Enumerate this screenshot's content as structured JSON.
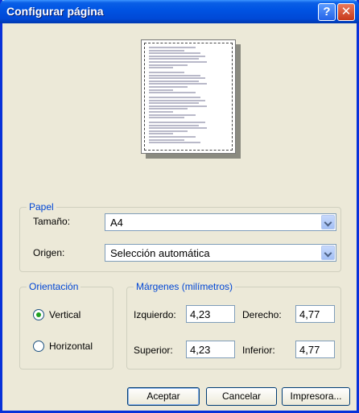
{
  "window": {
    "title": "Configurar página"
  },
  "titlebar": {
    "help_label": "?",
    "close_label": "✕"
  },
  "paper": {
    "group_label": "Papel",
    "size_label": "Tamaño:",
    "size_value": "A4",
    "source_label": "Origen:",
    "source_value": "Selección automática"
  },
  "orientation": {
    "group_label": "Orientación",
    "options": [
      {
        "label": "Vertical",
        "checked": true
      },
      {
        "label": "Horizontal",
        "checked": false
      }
    ]
  },
  "margins": {
    "group_label": "Márgenes (milímetros)",
    "left_label": "Izquierdo:",
    "left_value": "4,23",
    "right_label": "Derecho:",
    "right_value": "4,77",
    "top_label": "Superior:",
    "top_value": "4,23",
    "bottom_label": "Inferior:",
    "bottom_value": "4,77"
  },
  "buttons": {
    "ok": "Aceptar",
    "cancel": "Cancelar",
    "printer": "Impresora..."
  }
}
